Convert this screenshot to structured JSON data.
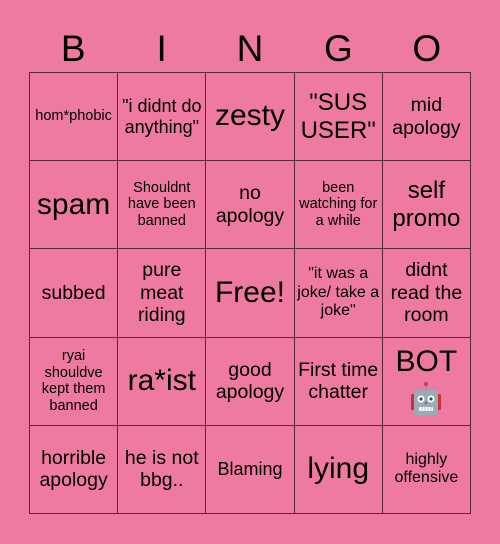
{
  "header": {
    "letters": [
      "B",
      "I",
      "N",
      "G",
      "O"
    ]
  },
  "grid": {
    "rows": [
      [
        "hom*phobic",
        "\"i didnt do anything\"",
        "zesty",
        "\"SUS USER\"",
        "mid apology"
      ],
      [
        "spam",
        "Shouldnt have been banned",
        "no apology",
        "been watching for a while",
        "self promo"
      ],
      [
        "subbed",
        "pure meat riding",
        "Free!",
        "\"it was a joke/ take a joke\"",
        "didnt read the room"
      ],
      [
        "ryai shouldve kept them banned",
        "ra*ist",
        "good apology",
        "First time chatter",
        "BOT"
      ],
      [
        "horrible apology",
        "he is not bbg..",
        "Blaming",
        "lying",
        "highly offensive"
      ]
    ],
    "bot_icon": "robot-icon"
  },
  "colors": {
    "background": "#ee7aa4",
    "grid_line": "#5a2a3c",
    "text": "#000000"
  }
}
